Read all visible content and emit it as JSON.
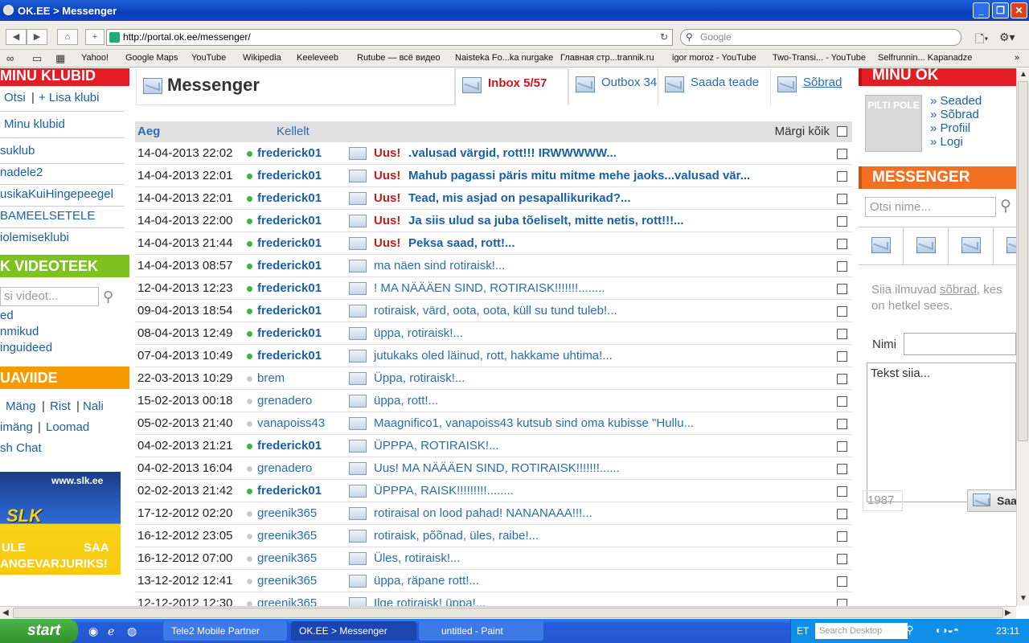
{
  "window": {
    "title": "OK.EE > Messenger"
  },
  "browser": {
    "url": "http://portal.ok.ee/messenger/",
    "search_placeholder": "Google",
    "bookmarks": [
      "Yahoo!",
      "Google Maps",
      "YouTube",
      "Wikipedia",
      "Keeleveeb",
      "Rutube — всё видео",
      "Naisteka Fo...ka nurgake",
      "Главная стр...trannik.ru",
      "igor moroz - YouTube",
      "Two-Transi... - YouTube",
      "Selfrunnin... Kapanadze"
    ]
  },
  "left": {
    "klubid_head": "MINU KLUBID",
    "otsi": "Otsi",
    "lisa_klubi": "+ Lisa klubi",
    "minu_klubid": "Minu klubid",
    "clubs": [
      "suklub",
      "nadele2",
      "usikaKuiHingepeegel",
      "BAMEELSETELE",
      "iolemiseklubi"
    ],
    "videoteek_head": "K VIDEOTEEK",
    "video_placeholder": "si videot...",
    "video_links": [
      "ed",
      "nmikud",
      "inguideed"
    ],
    "uaviide_head": "UAVIIDE",
    "game_row1": [
      "Mäng",
      "Rist",
      "Nali"
    ],
    "game_row2": [
      "imäng",
      "Loomad"
    ],
    "game_row3": "sh Chat",
    "banner_url": "www.slk.ee",
    "banner_logo": "SLK",
    "banner_line1": "ULE",
    "banner_line1b": "SAA",
    "banner_line2": "ANGEVARJURIKS!"
  },
  "messenger": {
    "title": "Messenger",
    "tabs": {
      "inbox": "Inbox 5/57",
      "outbox": "Outbox 34",
      "saada": "Saada teade",
      "sobrad": "Sõbrad"
    },
    "columns": {
      "aeg": "Aeg",
      "kellelt": "Kellelt",
      "margi": "Märgi kõik"
    },
    "uus_label": "Uus!",
    "rows": [
      {
        "date": "14-04-2013 22:02",
        "online": true,
        "from": "frederick01",
        "new": true,
        "text": ".valusad värgid, rott!!! IRWWWWW..."
      },
      {
        "date": "14-04-2013 22:01",
        "online": true,
        "from": "frederick01",
        "new": true,
        "text": "Mahub pagassi päris mitu mitme mehe jaoks...valusad vär..."
      },
      {
        "date": "14-04-2013 22:01",
        "online": true,
        "from": "frederick01",
        "new": true,
        "text": "Tead, mis asjad on pesapallikurikad?..."
      },
      {
        "date": "14-04-2013 22:00",
        "online": true,
        "from": "frederick01",
        "new": true,
        "text": "Ja siis ulud sa juba tõeliselt, mitte netis, rott!!!..."
      },
      {
        "date": "14-04-2013 21:44",
        "online": true,
        "from": "frederick01",
        "new": true,
        "text": "Peksa saad, rott!..."
      },
      {
        "date": "14-04-2013 08:57",
        "online": true,
        "from": "frederick01",
        "new": false,
        "text": "ma näen sind rotiraisk!..."
      },
      {
        "date": "12-04-2013 12:23",
        "online": true,
        "from": "frederick01",
        "new": false,
        "text": "! MA NÄÄÄEN SIND, ROTIRAISK!!!!!!!........"
      },
      {
        "date": "09-04-2013 18:54",
        "online": true,
        "from": "frederick01",
        "new": false,
        "text": "rotiraisk, värd, oota, oota, küll su tund tuleb!..."
      },
      {
        "date": "08-04-2013 12:49",
        "online": true,
        "from": "frederick01",
        "new": false,
        "text": "üppa, rotiraisk!..."
      },
      {
        "date": "07-04-2013 10:49",
        "online": true,
        "from": "frederick01",
        "new": false,
        "text": "jutukaks oled läinud, rott, hakkame uhtima!..."
      },
      {
        "date": "22-03-2013 10:29",
        "online": false,
        "from": "brem",
        "new": false,
        "text": "Üppa, rotiraisk!..."
      },
      {
        "date": "15-02-2013 00:18",
        "online": false,
        "from": "grenadero",
        "new": false,
        "text": "üppa, rott!..."
      },
      {
        "date": "05-02-2013 21:40",
        "online": false,
        "from": "vanapoiss43",
        "new": false,
        "text": "Maagnifico1, vanapoiss43 kutsub sind oma kubisse \"Hullu..."
      },
      {
        "date": "04-02-2013 21:21",
        "online": true,
        "from": "frederick01",
        "new": false,
        "text": "ÜPPPA, ROTIRAISK!..."
      },
      {
        "date": "04-02-2013 16:04",
        "online": false,
        "from": "grenadero",
        "new": false,
        "text": "Uus! MA NÄÄÄEN SIND, ROTIRAISK!!!!!!!......"
      },
      {
        "date": "02-02-2013 21:42",
        "online": true,
        "from": "frederick01",
        "new": false,
        "text": "ÜPPPA, RAISK!!!!!!!!!........"
      },
      {
        "date": "17-12-2012 02:20",
        "online": false,
        "from": "greenik365",
        "new": false,
        "text": "rotiraisal on lood pahad! NANANAAA!!!..."
      },
      {
        "date": "16-12-2012 23:05",
        "online": false,
        "from": "greenik365",
        "new": false,
        "text": "rotiraisk, põõnad, üles, raibe!..."
      },
      {
        "date": "16-12-2012 07:00",
        "online": false,
        "from": "greenik365",
        "new": false,
        "text": "Üles, rotiraisk!..."
      },
      {
        "date": "13-12-2012 12:41",
        "online": false,
        "from": "greenik365",
        "new": false,
        "text": "üppa, räpane rott!..."
      },
      {
        "date": "12-12-2012 12:30",
        "online": false,
        "from": "greenik365",
        "new": false,
        "text": "Ilge rotiraisk! üppa!..."
      }
    ]
  },
  "right": {
    "minuok_head": "MINU OK",
    "avatar_text": "PILTI POLE",
    "links": [
      "» Seaded",
      "» Sõbrad",
      "» Profiil",
      "» Logi"
    ],
    "messenger_head": "MESSENGER",
    "name_placeholder": "Otsi nime...",
    "note_pre": "Siia ilmuvad",
    "note_link": "sõbrad",
    "note_post": ", kes on hetkel sees.",
    "nimi_label": "Nimi",
    "tekst_placeholder": "Tekst siia...",
    "counter": "1987",
    "saada_btn": "Saad"
  },
  "taskbar": {
    "start": "start",
    "tasks": [
      "Tele2 Mobile Partner",
      "OK.EE > Messenger",
      "untitled - Paint"
    ],
    "lang": "ET",
    "search": "Search Desktop",
    "clock": "23:11"
  },
  "colors": {
    "brand_red": "#e31d23",
    "green": "#7dc21e",
    "orange": "#f59a00",
    "link": "#1a5fa8"
  }
}
